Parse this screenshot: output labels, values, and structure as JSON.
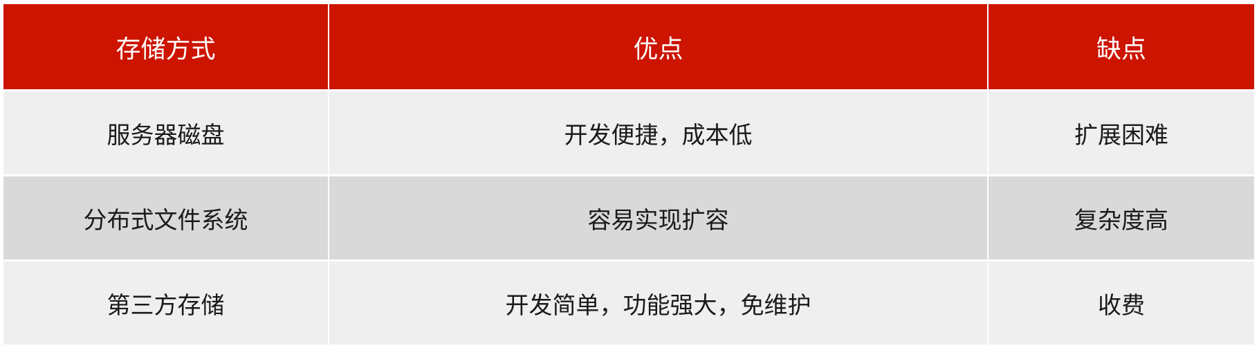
{
  "table": {
    "headers": [
      "存储方式",
      "优点",
      "缺点"
    ],
    "rows": [
      {
        "method": "服务器磁盘",
        "pros": "开发便捷，成本低",
        "cons": "扩展困难"
      },
      {
        "method": "分布式文件系统",
        "pros": "容易实现扩容",
        "cons": "复杂度高"
      },
      {
        "method": "第三方存储",
        "pros": "开发简单，功能强大，免维护",
        "cons": "收费"
      }
    ]
  },
  "colors": {
    "header_bg": "#cc1400",
    "header_text": "#ffffff",
    "row_light": "#efefef",
    "row_dark": "#d9d9d9"
  }
}
